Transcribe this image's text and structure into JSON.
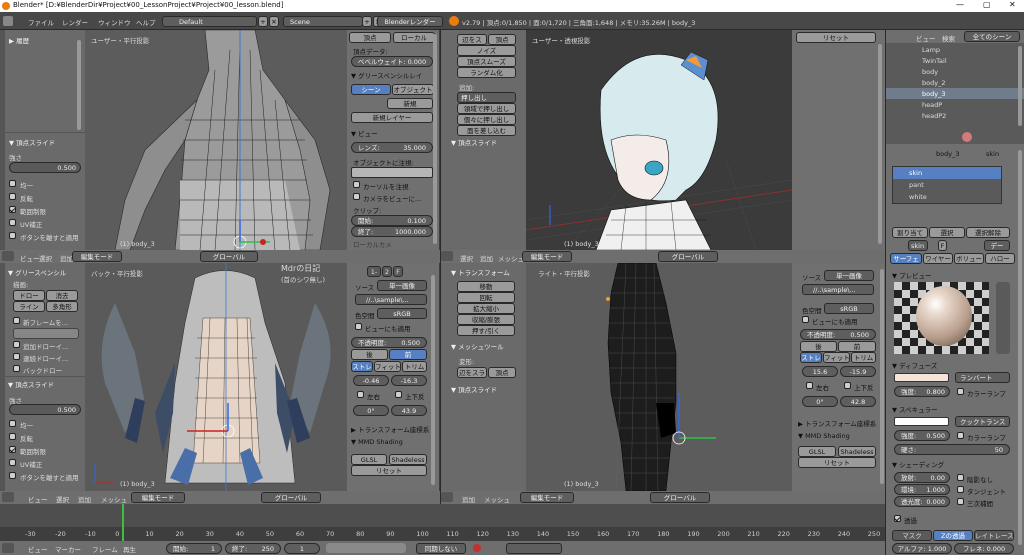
{
  "window": {
    "title": "Blender* [D:¥BlenderDir¥Project¥00_LessonProject¥Project¥00_lesson.blend]",
    "min": "—",
    "max": "▢",
    "close": "✕"
  },
  "menubar": {
    "file": "ファイル",
    "render": "レンダー",
    "window": "ウィンドウ",
    "help": "ヘルプ",
    "layout": "Default",
    "scene": "Scene",
    "engine": "Blenderレンダー",
    "stats": "v2.79 | 頂点:0/1,850 | 面:0/1,720 | 三角面:1,648 | メモリ:35.26M | body_3"
  },
  "tl": {
    "history": "履歴",
    "view_label": "ユーザー・平行投影",
    "obj_label": "(1) body_3",
    "vertex_slide": "頂点スライド",
    "strength": "強さ",
    "strength_val": "0.500",
    "opts": [
      "均一",
      "反転",
      "範囲制限",
      "UV補正",
      "ボタンを離すと適用"
    ],
    "props": {
      "vertex_data": "頂点データ:",
      "bevel": "ベベルウェイト: 0.000",
      "grease": "グリースペンシルレイ",
      "scene": "シーン",
      "object": "オブジェクト",
      "new": "新規",
      "new_layer": "新規レイヤー",
      "view": "ビュー",
      "lens": "レンズ:",
      "lens_val": "35.000",
      "lock_obj": "オブジェクトに注視:",
      "lock_cursor": "カーソルを注視",
      "lock_cam": "カメラをビューに...",
      "clip": "クリップ:",
      "clip_start": "開始:",
      "clip_start_val": "0.100",
      "clip_end": "終了:",
      "clip_end_val": "1000.000",
      "local_cam": "ローカルカメ",
      "tab_vertex": "頂点",
      "tab_local": "ローカル"
    }
  },
  "tr": {
    "view_label": "ユーザー・透視投影",
    "obj_label": "(1) body_3",
    "reset": "リセット",
    "tools": [
      "辺をス",
      "頂点",
      "ノイズ",
      "頂点スムーズ",
      "ランダム化"
    ],
    "add": "追加:",
    "extrude": "押し出し",
    "extrude_region": "領域で押し出し",
    "extrude_indiv": "個々に押し出し",
    "extrude_faces": "面を差し込む",
    "vertex_slide": "頂点スライド"
  },
  "hdr_left": {
    "view": "ビュー",
    "select": "選択",
    "add": "追加",
    "mesh": "メッシュ",
    "mode": "編集モード",
    "global": "グローバル"
  },
  "bl": {
    "grease": "グリースペンシル",
    "draw": "描画:",
    "draw_btn": "ドロー",
    "erase": "消去",
    "line": "ライン",
    "poly": "多角形",
    "new_frame": "新フレームを...",
    "add_draw": "追加ドローイ...",
    "sequence": "連続ドローイ...",
    "back_draw": "バックドロー",
    "view_label": "バック・平行投影",
    "obj_label": "(1) body_3",
    "annot": "Mdrの日記",
    "annot2": "(首のシワ無し)",
    "vertex_slide": "頂点スライド",
    "strength": "強さ",
    "strength_val": "0.500",
    "opts": [
      "均一",
      "反転",
      "範囲制限",
      "UV補正",
      "ボタンを離すと適用"
    ],
    "img": {
      "source": "ソース",
      "source_val": "単一画像",
      "path": "//..\\sample\\...",
      "colorspace": "色空間",
      "srgb": "sRGB",
      "view_apply": "ビューにも適用",
      "opacity": "不透明度:",
      "opacity_val": "0.500",
      "back": "後",
      "front": "前",
      "stretch": "ストレ",
      "fit": "フィット",
      "crop": "トリム",
      "x": "-0.46",
      "y": "-16.3",
      "lr": "左右",
      "ud": "上下反",
      "rot": "0°",
      "size": "43.9",
      "transform": "トランスフォーム座標系",
      "mmd": "MMD Shading",
      "glsl": "GLSL",
      "shadeless": "Shadeless",
      "reset": "リセット"
    }
  },
  "bm": {
    "transform": "トランスフォーム",
    "move": "移動",
    "rotate": "回転",
    "scale": "拡大縮小",
    "mirror": "収縮/膨張",
    "push": "押す/引く",
    "mesh_tools": "メッシュツール",
    "deform": "変形:",
    "edge_slide": "辺をスラ",
    "vertex": "頂点",
    "vertex_slide": "頂点スライド"
  },
  "br": {
    "view_label": "ライト・平行投影",
    "obj_label": "(1) body_3",
    "img": {
      "source": "ソース",
      "source_val": "単一画像",
      "path": "//..\\sample\\...",
      "colorspace": "色空間",
      "srgb": "sRGB",
      "view_apply": "ビューにも適用",
      "opacity": "不透明度:",
      "opacity_val": "0.500",
      "back": "後",
      "front": "前",
      "stretch": "ストレ",
      "fit": "フィット",
      "crop": "トリム",
      "x": "15.6",
      "y": "-15.9",
      "lr": "左右",
      "ud": "上下反",
      "rot": "0°",
      "size": "42.8",
      "transform": "トランスフォーム座標系",
      "mmd": "MMD Shading",
      "glsl": "GLSL",
      "shadeless": "Shadeless",
      "reset": "リセット"
    }
  },
  "outliner": {
    "view": "ビュー",
    "search": "検索",
    "all_scenes": "全てのシーン",
    "items": [
      "Lamp",
      "TwinTail",
      "body",
      "body_2",
      "body_3",
      "headP",
      "headP2"
    ]
  },
  "props": {
    "crumb_a": "body_3",
    "crumb_b": "skin",
    "materials": [
      "skin",
      "pant",
      "white"
    ],
    "assign": "割り当て",
    "select": "選択",
    "deselect": "選択解除",
    "mat_name": "skin",
    "f": "F",
    "data": "デー",
    "tabs": [
      "サーフェ",
      "ワイヤー",
      "ボリュー",
      "ハロー"
    ],
    "preview": "プレビュー",
    "diffuse": "ディフューズ",
    "lambert": "ランバート",
    "intensity": "強度:",
    "diffuse_val": "0.800",
    "ramp": "カラーランプ",
    "specular": "スペキュラー",
    "cooktorr": "クックトランス",
    "spec_val": "0.500",
    "hardness": "硬さ:",
    "hard_val": "50",
    "shading": "シェーディング",
    "emit": "放射:",
    "emit_val": "0.00",
    "shadeless": "陰影なし",
    "ambient": "環境:",
    "amb_val": "1.000",
    "tangent": "タンジェント",
    "translucency": "透光度:",
    "trans_val": "0.000",
    "cubic": "三次補間",
    "transparency": "透過",
    "mask": "マスク",
    "zbuffer": "Zの透過",
    "raytrace": "レイトレース",
    "alpha": "アルファ: 1.000",
    "fresnel": "フレネ: 0.000"
  },
  "timeline": {
    "ticks": [
      "-30",
      "-20",
      "-10",
      "0",
      "10",
      "20",
      "30",
      "40",
      "50",
      "60",
      "70",
      "80",
      "90",
      "100",
      "110",
      "120",
      "130",
      "140",
      "150",
      "160",
      "170",
      "180",
      "190",
      "200",
      "210",
      "220",
      "230",
      "240",
      "250"
    ],
    "view": "ビュー",
    "marker": "マーカー",
    "frame": "フレーム",
    "play": "再生",
    "start": "開始:",
    "start_val": "1",
    "end": "終了:",
    "end_val": "250",
    "current": "1",
    "sync": "同期しない"
  },
  "colors": {
    "accent": "#5680c2",
    "header": "#727272",
    "viewport_grey": "#5c5c5c",
    "viewport_dark": "#3a3a3a",
    "orange_sel": "#f29a3a"
  }
}
